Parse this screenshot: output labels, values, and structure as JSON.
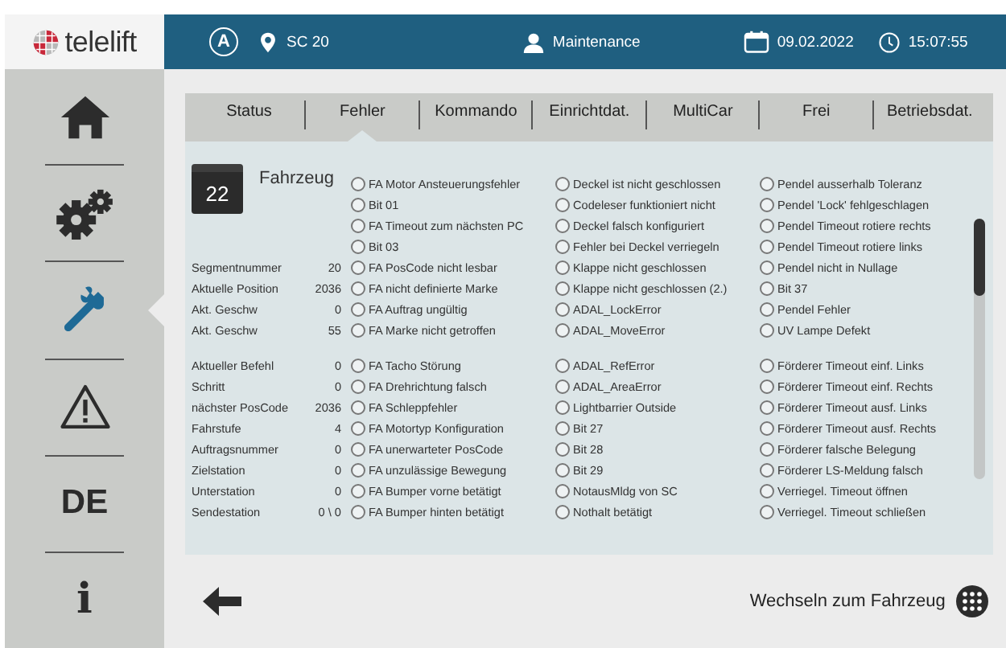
{
  "header": {
    "logo": "telelift",
    "mode": "A",
    "location": "SC 20",
    "user": "Maintenance",
    "date": "09.02.2022",
    "time": "15:07:55"
  },
  "sidebar": {
    "items": [
      {
        "kind": "home",
        "selected": false
      },
      {
        "kind": "gears",
        "selected": false
      },
      {
        "kind": "wrench",
        "selected": true
      },
      {
        "kind": "warning",
        "selected": false
      },
      {
        "kind": "language",
        "label": "DE",
        "selected": false
      },
      {
        "kind": "info",
        "label": "i",
        "selected": false
      }
    ]
  },
  "tabs": [
    {
      "label": "Status",
      "selected": false
    },
    {
      "label": "Fehler",
      "selected": true
    },
    {
      "label": "Kommando",
      "selected": false
    },
    {
      "label": "Einrichtdat.",
      "selected": false
    },
    {
      "label": "MultiCar",
      "selected": false
    },
    {
      "label": "Frei",
      "selected": false
    },
    {
      "label": "Betriebsdat.",
      "selected": false
    }
  ],
  "vehicle": {
    "number": "22",
    "title": "Fahrzeug"
  },
  "groups": [
    {
      "info": [
        {
          "label": "Segmentnummer",
          "value": "20"
        },
        {
          "label": "Aktuelle Position",
          "value": "2036"
        },
        {
          "label": "Akt. Geschw",
          "value": "0"
        },
        {
          "label": "Akt. Geschw",
          "value": "55"
        }
      ],
      "rows": [
        [
          {
            "label": "FA Motor Ansteuerungsfehler",
            "on": false
          },
          {
            "label": "Deckel ist nicht geschlossen",
            "on": false
          },
          {
            "label": "Pendel ausserhalb Toleranz",
            "on": false
          }
        ],
        [
          {
            "label": "Bit 01",
            "on": false
          },
          {
            "label": "Codeleser funktioniert nicht",
            "on": false
          },
          {
            "label": "Pendel 'Lock' fehlgeschlagen",
            "on": false
          }
        ],
        [
          {
            "label": "FA Timeout zum nächsten PC",
            "on": false
          },
          {
            "label": "Deckel falsch konfiguriert",
            "on": false
          },
          {
            "label": "Pendel Timeout rotiere rechts",
            "on": false
          }
        ],
        [
          {
            "label": "Bit 03",
            "on": false
          },
          {
            "label": "Fehler bei Deckel verriegeln",
            "on": false
          },
          {
            "label": "Pendel Timeout rotiere links",
            "on": false
          }
        ],
        [
          {
            "label": "FA PosCode nicht lesbar",
            "on": false
          },
          {
            "label": "Klappe nicht geschlossen",
            "on": false
          },
          {
            "label": "Pendel nicht in Nullage",
            "on": false
          }
        ],
        [
          {
            "label": "FA nicht definierte Marke",
            "on": false
          },
          {
            "label": "Klappe nicht geschlossen (2.)",
            "on": false
          },
          {
            "label": "Bit 37",
            "on": false
          }
        ],
        [
          {
            "label": "FA Auftrag ungültig",
            "on": false
          },
          {
            "label": "ADAL_LockError",
            "on": false
          },
          {
            "label": "Pendel Fehler",
            "on": false
          }
        ],
        [
          {
            "label": "FA Marke nicht getroffen",
            "on": false
          },
          {
            "label": "ADAL_MoveError",
            "on": false
          },
          {
            "label": "UV Lampe Defekt",
            "on": false
          }
        ]
      ]
    },
    {
      "info": [
        {
          "label": "Aktueller Befehl",
          "value": "0"
        },
        {
          "label": "Schritt",
          "value": "0"
        },
        {
          "label": "nächster PosCode",
          "value": "2036"
        },
        {
          "label": "Fahrstufe",
          "value": "4"
        },
        {
          "label": "Auftragsnummer",
          "value": "0"
        },
        {
          "label": "Zielstation",
          "value": "0"
        },
        {
          "label": "Unterstation",
          "value": "0"
        },
        {
          "label": "Sendestation",
          "value": "0 \\ 0"
        }
      ],
      "rows": [
        [
          {
            "label": "FA Tacho Störung",
            "on": false
          },
          {
            "label": "ADAL_RefError",
            "on": false
          },
          {
            "label": "Förderer Timeout einf. Links",
            "on": false
          }
        ],
        [
          {
            "label": "FA Drehrichtung falsch",
            "on": false
          },
          {
            "label": "ADAL_AreaError",
            "on": false
          },
          {
            "label": "Förderer Timeout einf. Rechts",
            "on": false
          }
        ],
        [
          {
            "label": "FA Schleppfehler",
            "on": false
          },
          {
            "label": "Lightbarrier Outside",
            "on": false
          },
          {
            "label": "Förderer Timeout ausf. Links",
            "on": false
          }
        ],
        [
          {
            "label": "FA Motortyp Konfiguration",
            "on": false
          },
          {
            "label": "Bit 27",
            "on": false
          },
          {
            "label": "Förderer Timeout ausf. Rechts",
            "on": false
          }
        ],
        [
          {
            "label": "FA unerwarteter PosCode",
            "on": false
          },
          {
            "label": "Bit 28",
            "on": false
          },
          {
            "label": "Förderer falsche Belegung",
            "on": false
          }
        ],
        [
          {
            "label": "FA unzulässige Bewegung",
            "on": false
          },
          {
            "label": "Bit 29",
            "on": false
          },
          {
            "label": "Förderer LS-Meldung falsch",
            "on": false
          }
        ],
        [
          {
            "label": "FA Bumper vorne betätigt",
            "on": false
          },
          {
            "label": "NotausMldg von SC",
            "on": false
          },
          {
            "label": "Verriegel. Timeout öffnen",
            "on": false
          }
        ],
        [
          {
            "label": "FA Bumper hinten betätigt",
            "on": false
          },
          {
            "label": "Nothalt betätigt",
            "on": false
          },
          {
            "label": "Verriegel. Timeout schließen",
            "on": false
          }
        ]
      ]
    }
  ],
  "footer": {
    "switch_label": "Wechseln zum Fahrzeug"
  }
}
